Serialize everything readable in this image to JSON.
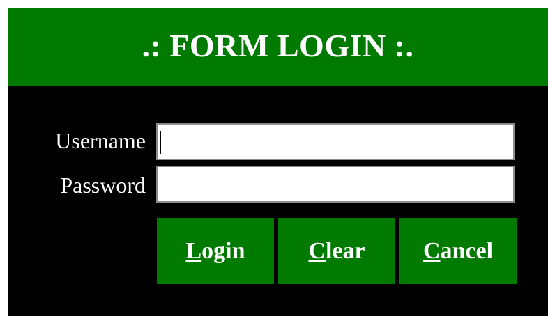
{
  "header": {
    "title": ".: FORM LOGIN :."
  },
  "form": {
    "username_label": "Username",
    "username_value": "",
    "password_label": "Password",
    "password_value": ""
  },
  "buttons": {
    "login": {
      "accel": "L",
      "rest": "ogin"
    },
    "clear": {
      "accel": "C",
      "rest": "lear"
    },
    "cancel": {
      "accel": "C",
      "rest": "ancel"
    }
  },
  "colors": {
    "header_bg": "#007a00",
    "body_bg": "#000000",
    "button_bg": "#007a00",
    "text": "#ffffff"
  }
}
